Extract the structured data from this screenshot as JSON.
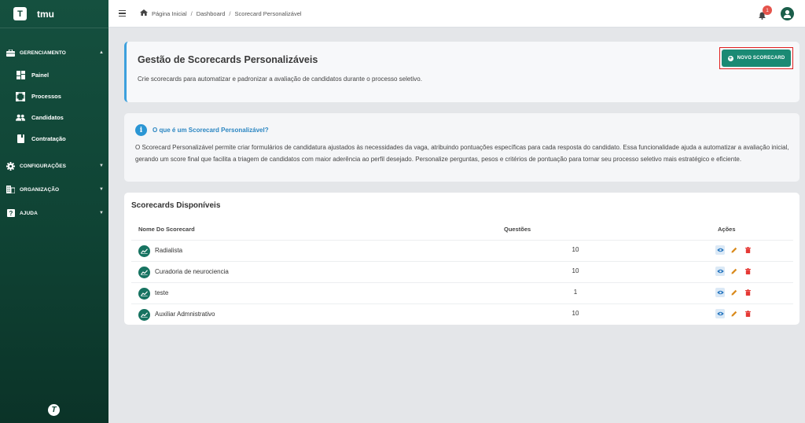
{
  "app": {
    "logo_letter": "T",
    "name": "tmu",
    "footer_logo": "T"
  },
  "sidebar": {
    "sections": [
      {
        "label": "GERENCIAMENTO",
        "icon": "briefcase-icon",
        "expanded": true,
        "items": [
          {
            "label": "Painel",
            "icon": "dashboard-icon"
          },
          {
            "label": "Processos",
            "icon": "process-icon"
          },
          {
            "label": "Candidatos",
            "icon": "people-icon"
          },
          {
            "label": "Contratação",
            "icon": "contract-icon"
          }
        ]
      },
      {
        "label": "CONFIGURAÇÕES",
        "icon": "gear-icon",
        "expanded": false
      },
      {
        "label": "ORGANIZAÇÃO",
        "icon": "building-icon",
        "expanded": false
      },
      {
        "label": "AJUDA",
        "icon": "help-icon",
        "expanded": false
      }
    ]
  },
  "topbar": {
    "breadcrumb": [
      "Página Inicial",
      "Dashboard",
      "Scorecard Personalizável"
    ],
    "notifications_count": "1"
  },
  "header": {
    "title": "Gestão de Scorecards Personalizáveis",
    "description": "Crie scorecards para automatizar e padronizar a avaliação de candidatos durante o processo seletivo.",
    "new_button": "NOVO SCORECARD"
  },
  "info": {
    "title": "O que é um Scorecard Personalizável?",
    "text": "O Scorecard Personalizável permite criar formulários de candidatura ajustados às necessidades da vaga, atribuindo pontuações específicas para cada resposta do candidato. Essa funcionalidade ajuda a automatizar a avaliação inicial, gerando um score final que facilita a triagem de candidatos com maior aderência ao perfil desejado. Personalize perguntas, pesos e critérios de pontuação para tornar seu processo seletivo mais estratégico e eficiente."
  },
  "list": {
    "title": "Scorecards Disponíveis",
    "columns": {
      "name": "Nome Do Scorecard",
      "questions": "Questões",
      "actions": "Ações"
    },
    "rows": [
      {
        "name": "Radialista",
        "questions": "10"
      },
      {
        "name": "Curadoria de neurociencia",
        "questions": "10"
      },
      {
        "name": "teste",
        "questions": "1"
      },
      {
        "name": "Auxiliar Admnistrativo",
        "questions": "10"
      }
    ]
  },
  "colors": {
    "sidebar": "#0f4334",
    "accent": "#1a8a74",
    "info_blue": "#2b96d4",
    "delete_red": "#e53935",
    "edit_orange": "#d98a1c"
  }
}
